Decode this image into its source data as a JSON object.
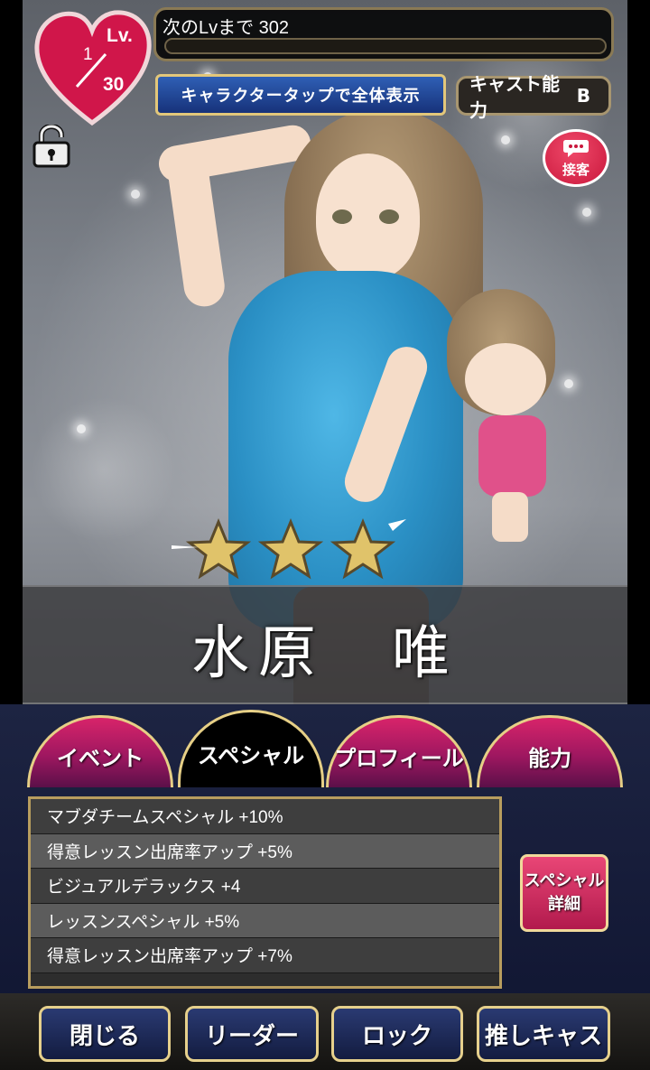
{
  "header": {
    "level_label": "Lv.",
    "level_current": "1",
    "level_max": "30",
    "next_level_text": "次のLvまで 302",
    "exp_progress": 0.0
  },
  "tap_banner": "キャラクタータップで全体表示",
  "cast_ability": {
    "label": "キャスト能力",
    "rank": "B"
  },
  "serve_button": "接客",
  "rarity_stars": 3,
  "character_name": "水原　唯",
  "tabs": [
    {
      "label": "イベント",
      "active": false
    },
    {
      "label": "スペシャル",
      "active": true
    },
    {
      "label": "プロフィール",
      "active": false
    },
    {
      "label": "能力",
      "active": false
    }
  ],
  "special_list": [
    "マブダチームスペシャル +10%",
    "得意レッスン出席率アップ +5%",
    "ビジュアルデラックス +4",
    "レッスンスペシャル +5%",
    "得意レッスン出席率アップ +7%"
  ],
  "special_detail_button": "スペシャル\n詳細",
  "bottom_buttons": {
    "close": "閉じる",
    "leader": "リーダー",
    "lock": "ロック",
    "favorite": "推しキャス"
  },
  "colors": {
    "heart": "#d0164a",
    "tab_pink": "#c91f66",
    "gold_border": "#e6cf86",
    "button_navy": "#1f2c5c"
  },
  "icons": [
    "heart-level-icon",
    "unlock-icon",
    "chat-bubble-icon",
    "star-icon"
  ]
}
